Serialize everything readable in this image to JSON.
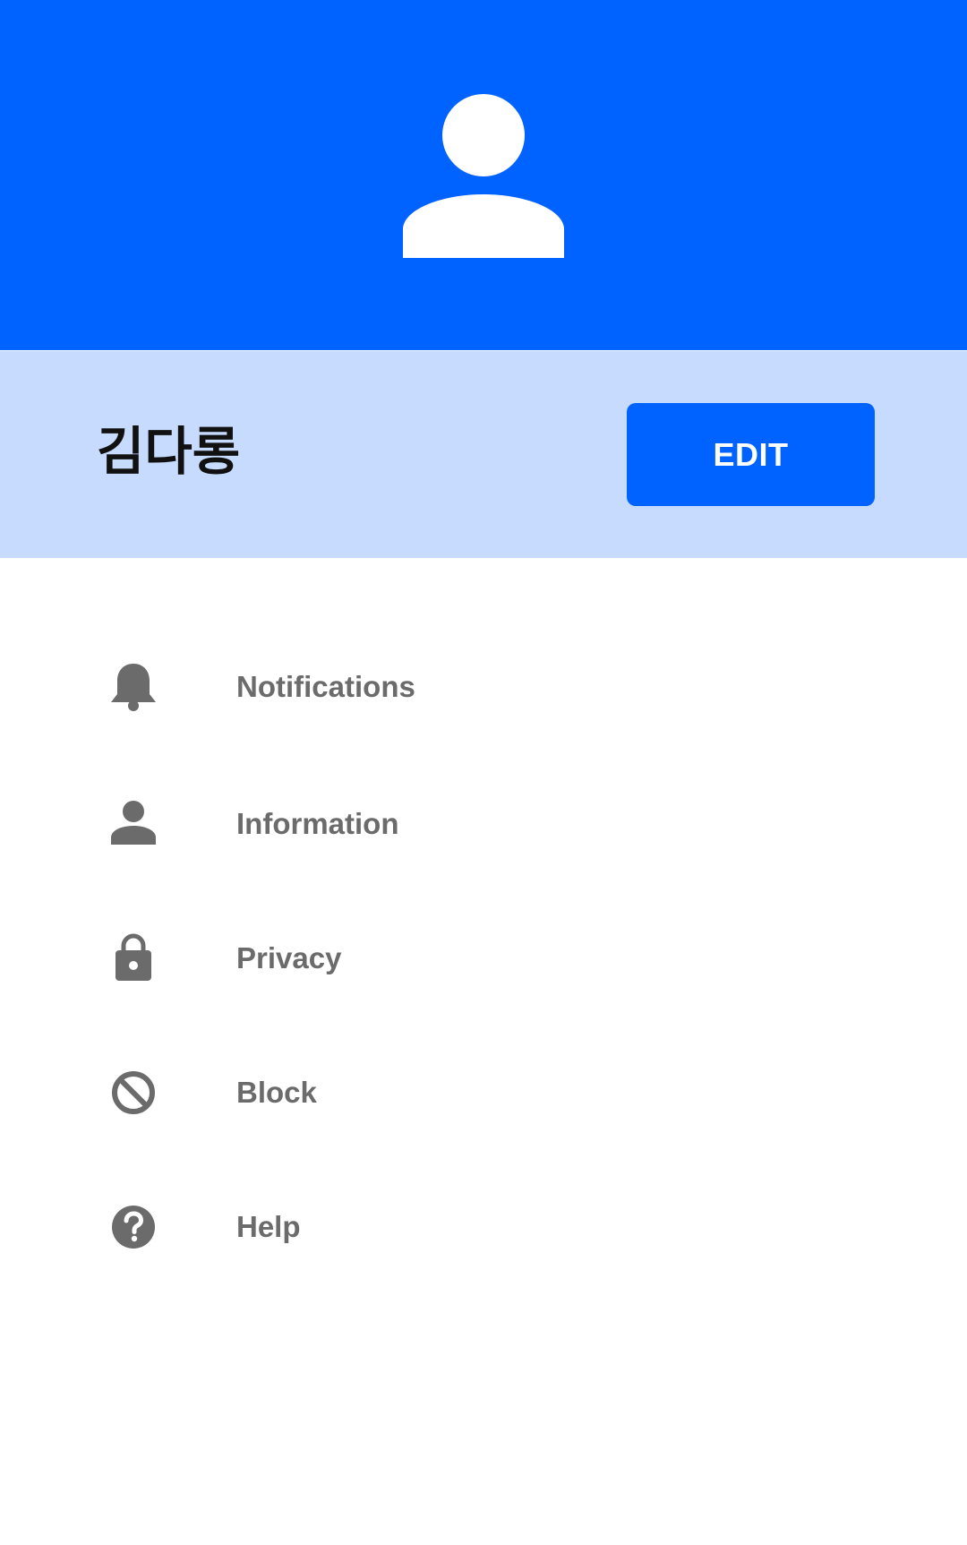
{
  "colors": {
    "header_bg": "#0062ff",
    "profile_bar_bg": "#c6dbfd",
    "accent": "#0062ff",
    "menu_text": "#6b6b6b",
    "menu_icon": "#6b6b6b"
  },
  "header": {
    "avatar_icon": "person-icon"
  },
  "profile": {
    "name": "김다롱",
    "edit_label": "EDIT"
  },
  "menu": {
    "items": [
      {
        "label": "Notifications",
        "icon": "bell-icon"
      },
      {
        "label": "Information",
        "icon": "person-icon"
      },
      {
        "label": "Privacy",
        "icon": "lock-icon"
      },
      {
        "label": "Block",
        "icon": "block-icon"
      },
      {
        "label": "Help",
        "icon": "help-icon"
      }
    ]
  }
}
